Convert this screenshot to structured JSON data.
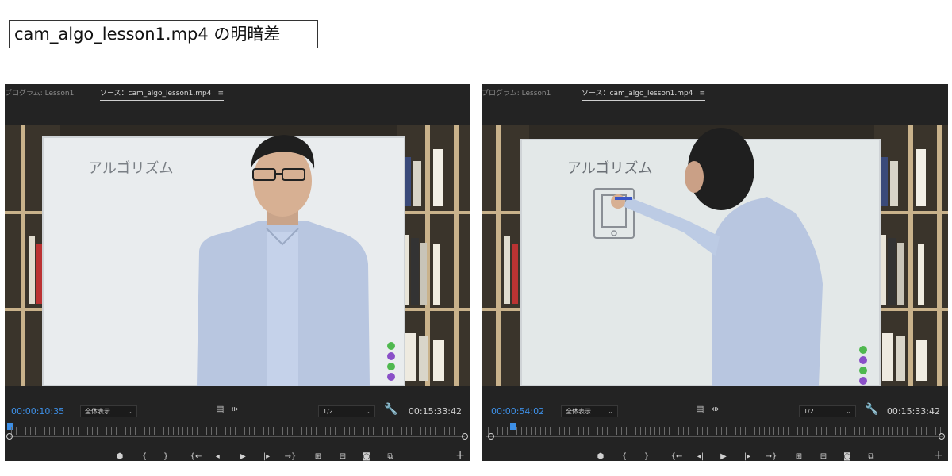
{
  "header": {
    "title": "cam_algo_lesson1.mp4 の明暗差"
  },
  "panels": [
    {
      "tab_program": "プログラム: Lesson1",
      "tab_source": "ソース：cam_algo_lesson1.mp4",
      "tab_menu": "≡",
      "whiteboard_text": "アルゴリズム",
      "current_time": "00:00:10:35",
      "zoom": "全体表示",
      "resolution": "1/2",
      "duration": "00:15:33:42",
      "playhead_fraction": 0.002
    },
    {
      "tab_program": "プログラム: Lesson1",
      "tab_source": "ソース：cam_algo_lesson1.mp4",
      "tab_menu": "≡",
      "whiteboard_text": "アルゴリズム",
      "current_time": "00:00:54:02",
      "zoom": "全体表示",
      "resolution": "1/2",
      "duration": "00:15:33:42",
      "playhead_fraction": 0.055
    }
  ],
  "icons": {
    "marker": "marker-icon",
    "mark_in": "mark-in-icon",
    "mark_out": "mark-out-icon",
    "go_to_in": "go-to-in-icon",
    "step_back": "step-back-icon",
    "play": "play-icon",
    "step_forward": "step-forward-icon",
    "go_to_out": "go-to-out-icon",
    "insert": "insert-icon",
    "overwrite": "overwrite-icon",
    "export_frame": "camera-icon",
    "button_editor": "button-editor-icon",
    "add": "plus-icon",
    "settings": "wrench-icon"
  },
  "colors": {
    "timecode_current": "#3d8fe6",
    "panel_bg": "#232323"
  }
}
